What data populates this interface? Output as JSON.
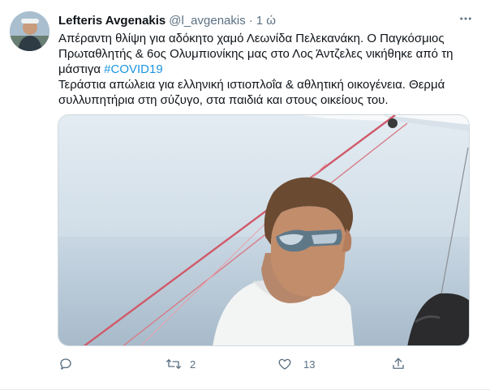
{
  "tweet": {
    "author": {
      "name": "Lefteris Avgenakis",
      "handle": "@l_avgenakis",
      "separator": "·",
      "time": "1 ώ"
    },
    "text": {
      "line1": "Απέραντη θλίψη για αδόκητο χαμό Λεωνίδα Πελεκανάκη. Ο Παγκόσμιος Πρωταθλητής & 6ος Ολυμπιονίκης μας στο Λος Άντζελες νικήθηκε από τη μάστιγα ",
      "hashtag": "#COVID19",
      "line2": "Τεράστια απώλεια για ελληνική ιστιοπλοΐα & αθλητική οικογένεια. Θερμά συλλυπητήρια στη σύζυγο, στα παιδιά και στους οικείους του."
    },
    "actions": {
      "reply_count": "",
      "retweet_count": "2",
      "like_count": "13",
      "share_count": ""
    },
    "icons": {
      "more": "more-icon",
      "reply": "reply-icon",
      "retweet": "retweet-icon",
      "like": "like-icon",
      "share": "share-icon"
    },
    "colors": {
      "link": "#1b95e0",
      "secondary_text": "#5b7083"
    }
  }
}
